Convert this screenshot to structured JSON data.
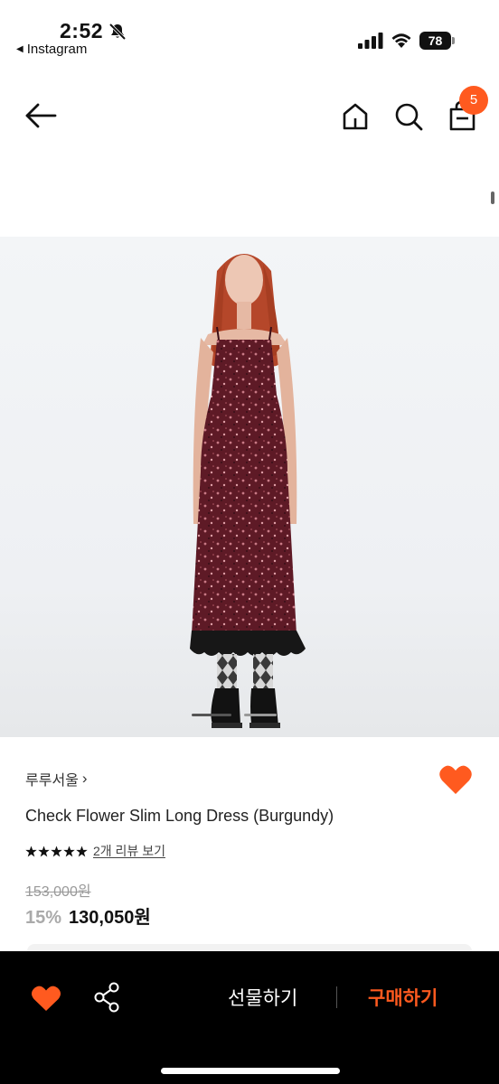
{
  "status_bar": {
    "time": "2:52",
    "back_app": "Instagram",
    "battery": "78"
  },
  "nav": {
    "cart_count": "5"
  },
  "product": {
    "brand": "루루서울",
    "brand_chevron": "›",
    "title": "Check Flower Slim Long Dress (Burgundy)",
    "rating_stars": 5,
    "review_link": "2개 리뷰 보기",
    "original_price": "153,000원",
    "discount": "15%",
    "sale_price": "130,050원"
  },
  "bottom_bar": {
    "gift_label": "선물하기",
    "buy_label": "구매하기"
  },
  "colors": {
    "accent": "#ff5a1f",
    "dress": "#5e1a26",
    "bar_bg": "#000000"
  },
  "icons": [
    "bell-slash-icon",
    "cellular-signal-icon",
    "wifi-icon",
    "battery-icon",
    "back-arrow-icon",
    "home-icon",
    "search-icon",
    "shopping-bag-icon",
    "heart-icon",
    "share-icon",
    "star-icon",
    "chevron-right-icon"
  ]
}
